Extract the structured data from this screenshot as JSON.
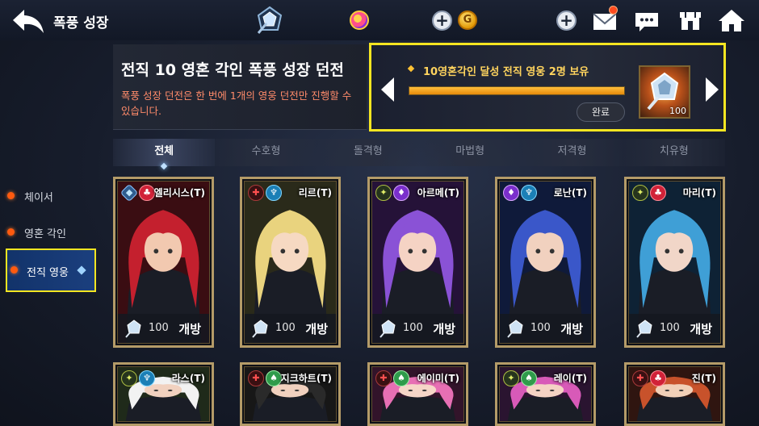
{
  "header": {
    "title": "폭풍 성장"
  },
  "sidebar": {
    "items": [
      {
        "label": "체이서",
        "active": false
      },
      {
        "label": "영혼 각인",
        "active": false
      },
      {
        "label": "전직 영웅",
        "active": true
      }
    ]
  },
  "dungeon": {
    "title": "전직 10 영혼 각인 폭풍 성장 던전",
    "description": "폭풍 성장 던전은 한 번에 1개의 영웅 던전만 진행할 수 있습니다."
  },
  "mission": {
    "text": "10영혼각인 달성 전직 영웅 2명 보유",
    "progress_fraction": 1.0,
    "complete_label": "완료",
    "reward_count": "100"
  },
  "tabs": [
    {
      "label": "전체",
      "active": true
    },
    {
      "label": "수호형",
      "active": false
    },
    {
      "label": "돌격형",
      "active": false
    },
    {
      "label": "마법형",
      "active": false
    },
    {
      "label": "저격형",
      "active": false
    },
    {
      "label": "치유형",
      "active": false
    }
  ],
  "heroes": [
    {
      "name": "엘리시스(T)",
      "count": "100",
      "status": "개방",
      "hair": "#c4202e",
      "skin": "#f2c9b0",
      "bg": "#3a0d12",
      "b1": "diamond",
      "b2": "red"
    },
    {
      "name": "리르(T)",
      "count": "100",
      "status": "개방",
      "hair": "#e9d37e",
      "skin": "#f6d9c2",
      "bg": "#2a2a1a",
      "b1": "darkred",
      "b2": "teal"
    },
    {
      "name": "아르메(T)",
      "count": "100",
      "status": "개방",
      "hair": "#8a52d6",
      "skin": "#f5d3c4",
      "bg": "#251238",
      "b1": "yellow",
      "b2": "purple"
    },
    {
      "name": "로난(T)",
      "count": "100",
      "status": "개방",
      "hair": "#3a57c9",
      "skin": "#f1d1bf",
      "bg": "#0f1a3a",
      "b1": "purple",
      "b2": "teal"
    },
    {
      "name": "마리(T)",
      "count": "100",
      "status": "개방",
      "hair": "#3f9fd6",
      "skin": "#f1d6c8",
      "bg": "#0e2235",
      "b1": "yellow",
      "b2": "red"
    },
    {
      "name": "라스(T)",
      "hair": "#f2f2f2",
      "skin": "#f1d1bf",
      "bg": "#1f2a1a",
      "b1": "yellow",
      "b2": "teal"
    },
    {
      "name": "지크하트(T)",
      "hair": "#2a2a2a",
      "skin": "#f1d1bf",
      "bg": "#171717",
      "b1": "darkred",
      "b2": "green"
    },
    {
      "name": "에이미(T)",
      "hair": "#e76fb4",
      "skin": "#f6d6c8",
      "bg": "#32142a",
      "b1": "darkred",
      "b2": "green"
    },
    {
      "name": "레이(T)",
      "hair": "#d85ab8",
      "skin": "#f4d3c4",
      "bg": "#2a1430",
      "b1": "yellow",
      "b2": "green"
    },
    {
      "name": "진(T)",
      "hair": "#c8522b",
      "skin": "#f1d0b8",
      "bg": "#2f1510",
      "b1": "darkred",
      "b2": "red"
    }
  ],
  "colors": {
    "highlight": "#f6e621",
    "accent_orange": "#ff5a0f",
    "progress": "#f5a623",
    "card_border": "#b49b68"
  },
  "icons": [
    "back-arrow-icon",
    "crystal-emblem-icon",
    "gem-coin-icon",
    "gold-coin-icon",
    "mail-icon",
    "chat-icon",
    "shop-icon",
    "home-icon"
  ]
}
